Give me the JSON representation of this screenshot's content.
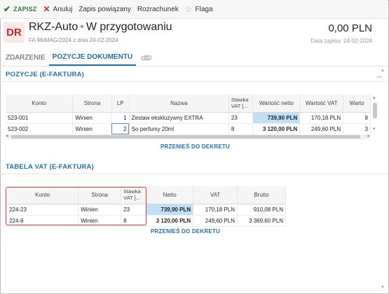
{
  "toolbar": {
    "save": "ZAPISZ",
    "cancel": "Anuluj",
    "linked_record": "Zapis powiązany",
    "settlement": "Rozrachunek",
    "flag": "Flaga"
  },
  "header": {
    "badge": "DR",
    "name": "RKZ-Auto",
    "separator": "•",
    "status": "W przygotowaniu",
    "subtitle": "FA 96/MAG/2024 z dnia 24-02-2024",
    "amount": "0,00 PLN",
    "save_date": "Data zapisu: 24-02-2024"
  },
  "tabs": [
    {
      "label": "ZDARZENIE",
      "active": false
    },
    {
      "label": "POZYCJE DOKUMENTU",
      "active": true
    }
  ],
  "icons": {
    "save": "check-icon",
    "cancel": "x-icon",
    "flag": "star-icon",
    "attachment": "paperclip-icon",
    "collapse": "chevron-up-icon"
  },
  "positions": {
    "title": "POZYCJE (E-FAKTURA)",
    "headers": [
      "Konto",
      "Strona",
      "LP",
      "Nazwa",
      "Stawka VAT [...",
      "Wartość netto",
      "Wartość VAT",
      "Warto"
    ],
    "rows": [
      [
        "523-001",
        "Winien",
        "1",
        "Zestaw ekskluzywny EXTRA",
        "23",
        "739,90 PLN",
        "170,18 PLN",
        "9"
      ],
      [
        "523-002",
        "Winien",
        "2",
        "So perfumy 20ml",
        "8",
        "3 120,00 PLN",
        "249,60 PLN",
        "3"
      ]
    ],
    "link": "PRZENIEŚ DO DEKRETU"
  },
  "vat_table": {
    "title": "TABELA VAT (E-FAKTURA)",
    "headers": [
      "Konto",
      "Strona",
      "Stawka VAT [...",
      "Netto",
      "VAT",
      "Brutto"
    ],
    "rows": [
      [
        "224-23",
        "Winien",
        "23",
        "739,90 PLN",
        "170,18 PLN",
        "910,08 PLN"
      ],
      [
        "224-8",
        "Winien",
        "8",
        "3 120,00 PLN",
        "249,60 PLN",
        "3 369,60 PLN"
      ]
    ],
    "link": "PRZENIEŚ DO DEKRETU"
  },
  "colors": {
    "accent": "#1f6fb2",
    "badge_bg": "#fde8e8",
    "badge_fg": "#c62828",
    "highlight": "#bfe0f7",
    "annotation_box": "#e53935"
  }
}
